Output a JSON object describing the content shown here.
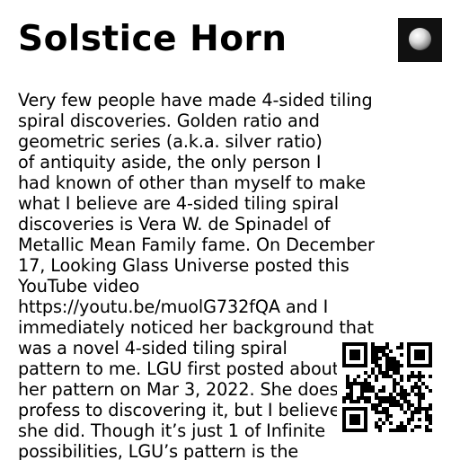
{
  "header": {
    "title": "Solstice Horn",
    "logo_icon": "sphere-logo-icon"
  },
  "article": {
    "lines": [
      "Very few people have made 4-sided tiling",
      "spiral discoveries. Golden ratio and",
      "geometric series (a.k.a. silver ratio)",
      "of antiquity aside, the only person I",
      "had known of other than myself to make",
      "what I believe are 4-sided tiling spiral",
      "discoveries is Vera W. de Spinadel of",
      "Metallic Mean Family fame. On December",
      "17, Looking Glass Universe posted this",
      "YouTube video",
      "https://youtu.be/muolG732fQA and I",
      "immediately noticed her background that",
      "was a novel 4-sided tiling spiral",
      "pattern to me. LGU first posted about",
      "her pattern on Mar 3, 2022. She doesn't",
      "profess to discovering it, but I believe",
      "she did. Though it’s just 1 of Infinite",
      "possibilities, LGU’s pattern is the"
    ]
  },
  "qr_code": {
    "icon": "qr-code-icon"
  },
  "colors": {
    "text": "#000000",
    "background": "#ffffff",
    "logo_background": "#111111"
  }
}
